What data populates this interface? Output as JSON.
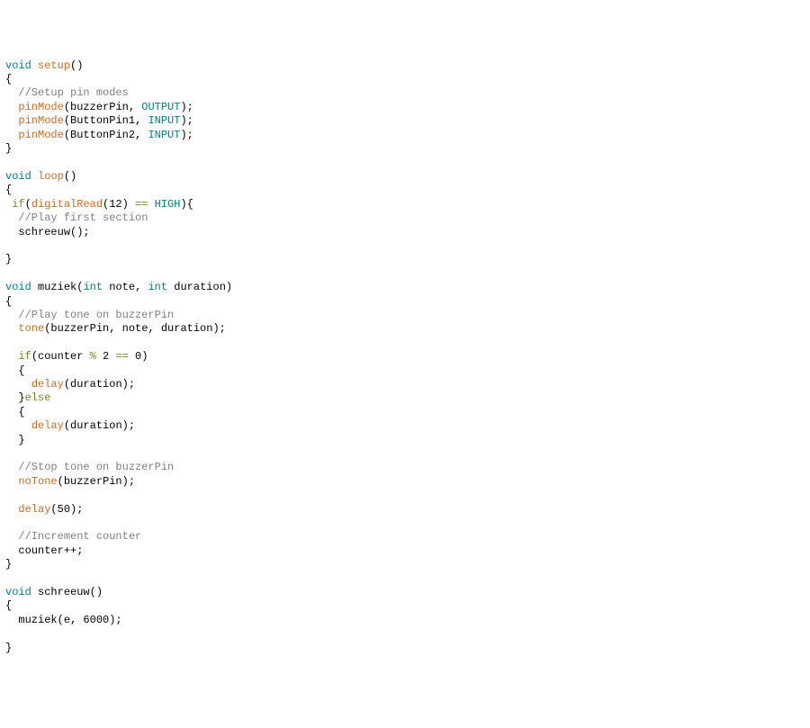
{
  "code": {
    "l01": {
      "void": "void",
      "setup": "setup",
      "paren": "()"
    },
    "l02": {
      "brace": "{"
    },
    "l03": {
      "indent": "  ",
      "comment": "//Setup pin modes"
    },
    "l04": {
      "indent": "  ",
      "fn": "pinMode",
      "open": "(",
      "arg1": "buzzerPin",
      "comma": ", ",
      "arg2": "OUTPUT",
      "close": ");"
    },
    "l05": {
      "indent": "  ",
      "fn": "pinMode",
      "open": "(",
      "arg1": "ButtonPin1",
      "comma": ", ",
      "arg2": "INPUT",
      "close": ");"
    },
    "l06": {
      "indent": "  ",
      "fn": "pinMode",
      "open": "(",
      "arg1": "ButtonPin2",
      "comma": ", ",
      "arg2": "INPUT",
      "close": ");"
    },
    "l07": {
      "brace": "}"
    },
    "l08": {
      "blank": " "
    },
    "l09": {
      "void": "void",
      "loop": "loop",
      "paren": "()"
    },
    "l10": {
      "brace": "{"
    },
    "l11": {
      "indent": " ",
      "if": "if",
      "open": "(",
      "fn": "digitalRead",
      "open2": "(",
      "num": "12",
      "close2": ")",
      "sp": " ",
      "eq": "==",
      "sp2": " ",
      "high": "HIGH",
      "close": "){"
    },
    "l12": {
      "indent": "  ",
      "comment": "//Play first section"
    },
    "l13": {
      "indent": "  ",
      "fn": "schreeuw",
      "paren": "();"
    },
    "l14": {
      "blank": " "
    },
    "l15": {
      "brace": "}"
    },
    "l16": {
      "blank": " "
    },
    "l17": {
      "void": "void",
      "muziek": "muziek",
      "open": "(",
      "int1": "int",
      "note": " note",
      "comma": ", ",
      "int2": "int",
      "dur": " duration",
      "close": ")"
    },
    "l18": {
      "brace": "{"
    },
    "l19": {
      "indent": "  ",
      "comment": "//Play tone on buzzerPin"
    },
    "l20": {
      "indent": "  ",
      "fn": "tone",
      "args": "(buzzerPin, note, duration);"
    },
    "l21": {
      "blank": " "
    },
    "l22": {
      "indent": "  ",
      "if": "if",
      "open": "(counter ",
      "op": "%",
      "mid": " 2 ",
      "eq": "==",
      "end": " 0)"
    },
    "l23": {
      "indent": "  ",
      "brace": "{"
    },
    "l24": {
      "indent": "    ",
      "fn": "delay",
      "args": "(duration);"
    },
    "l25": {
      "indent": "  ",
      "brace": "}",
      "else": "else"
    },
    "l26": {
      "indent": "  ",
      "brace": "{"
    },
    "l27": {
      "indent": "    ",
      "fn": "delay",
      "args": "(duration);"
    },
    "l28": {
      "indent": "  ",
      "brace": "}"
    },
    "l29": {
      "blank": " "
    },
    "l30": {
      "indent": "  ",
      "comment": "//Stop tone on buzzerPin"
    },
    "l31": {
      "indent": "  ",
      "fn": "noTone",
      "args": "(buzzerPin);"
    },
    "l32": {
      "blank": " "
    },
    "l33": {
      "indent": "  ",
      "fn": "delay",
      "args": "(50);"
    },
    "l34": {
      "blank": " "
    },
    "l35": {
      "indent": "  ",
      "comment": "//Increment counter"
    },
    "l36": {
      "indent": "  ",
      "text": "counter++;"
    },
    "l37": {
      "brace": "}"
    },
    "l38": {
      "blank": " "
    },
    "l39": {
      "void": "void",
      "schreeuw": "schreeuw",
      "paren": "()"
    },
    "l40": {
      "brace": "{"
    },
    "l41": {
      "indent": "  ",
      "fn": "muziek",
      "args": "(e, 6000);"
    },
    "l42": {
      "blank": " "
    },
    "l43": {
      "brace": "}"
    }
  }
}
